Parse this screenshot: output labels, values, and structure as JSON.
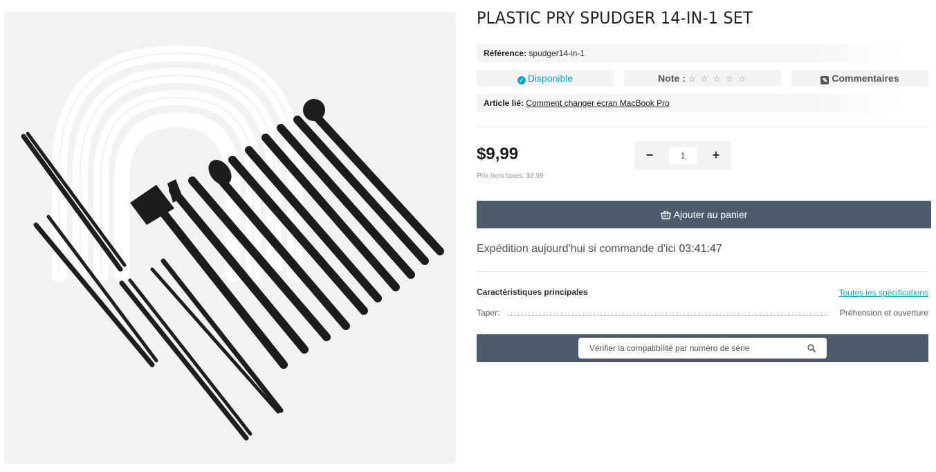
{
  "product": {
    "title": "PLASTIC PRY SPUDGER 14-IN-1 SET",
    "image_alt": "black plastic spudger tools set",
    "reference_label": "Référence:",
    "reference_value": "spudger14-in-1",
    "availability": "Disponible",
    "rating_label": "Note :",
    "rating_stars": "☆ ☆ ☆ ☆ ☆",
    "rating_value": 0,
    "comments_label": "Commentaires",
    "linked_article_label": "Article lié:",
    "linked_article_link": "Comment changer ecran MacBook Pro",
    "price": "$9,99",
    "price_excl_tax": "Prix hors taxes: $9,99",
    "quantity": "1",
    "add_to_cart": "Ajouter au panier",
    "shipping_text": "Expédition aujourd'hui si commande d'ici",
    "timer_h": "03",
    "timer_m": "41",
    "timer_s": "47",
    "specs_title": "Caractéristiques principales",
    "specs_link": "Toutes les spécifications",
    "specs": [
      {
        "key": "Taper:",
        "value": "Préhension et ouverture"
      }
    ],
    "compat_placeholder": "Vérifier la compatibilité par numéro de série"
  },
  "colors": {
    "accent": "#17a2c8",
    "button": "#4b5b69",
    "panel": "#f2f3f5"
  },
  "icons": {
    "availability": "check-circle-icon",
    "comments": "edit-icon",
    "cart": "basket-icon",
    "search": "search-icon",
    "qty_minus": "minus-icon",
    "qty_plus": "plus-icon"
  }
}
